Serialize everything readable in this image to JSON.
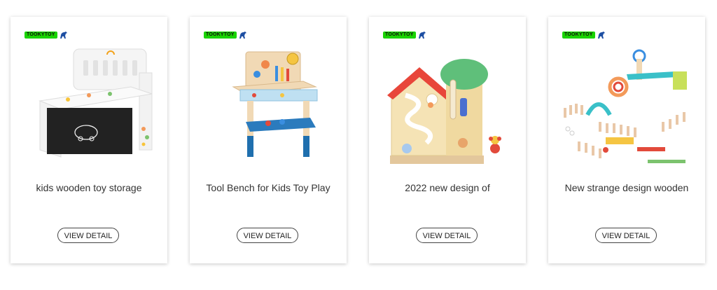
{
  "products": [
    {
      "brand": "TOOKYTOY",
      "title": "kids wooden toy storage",
      "button": "VIEW DETAIL",
      "image": "toy-storage-bench"
    },
    {
      "brand": "TOOKYTOY",
      "title": "Tool Bench for Kids Toy Play",
      "button": "VIEW DETAIL",
      "image": "tool-bench"
    },
    {
      "brand": "TOOKYTOY",
      "title": "2022 new design of",
      "button": "VIEW DETAIL",
      "image": "activity-board"
    },
    {
      "brand": "TOOKYTOY",
      "title": "New strange design wooden",
      "button": "VIEW DETAIL",
      "image": "domino-track"
    }
  ],
  "colors": {
    "brand_green": "#19d400",
    "brand_blue": "#1e4fa3"
  }
}
